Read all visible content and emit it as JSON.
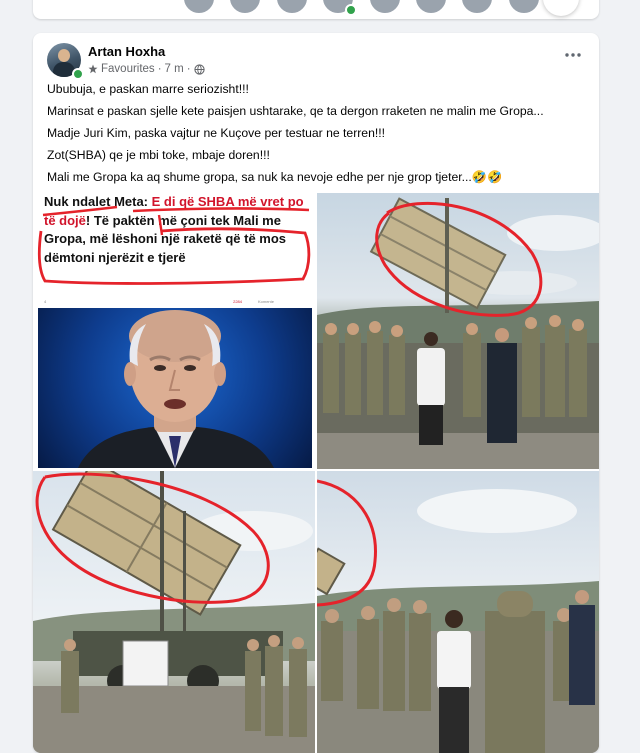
{
  "post": {
    "author": "Artan Hoxha",
    "audience": "Favourites",
    "separator": "·",
    "time": "7 m",
    "separator2": "·",
    "paragraphs": [
      "Ububuja, e paskan marre seriozisht!!!",
      "Marinsat e paskan sjelle kete paisjen ushtarake, qe ta dergon rraketen ne malin me Gropa...",
      "Madje Juri Kim, paska vajtur ne Kuçove per testuar ne terren!!!",
      "Zot(SHBA) qe je mbi toke, mbaje doren!!!",
      "Mali me Gropa ka aq shume gropa, sa nuk ka nevoje edhe per nje grop tjeter...🤣🤣"
    ]
  },
  "article": {
    "headline_dark": "Nuk ndalet Meta:",
    "headline_red": "E di që SHBA më vret po të dojë",
    "headline_rest": "! Të paktën më çoni tek Mali me Gropa, më lëshoni një raketë që të mos dëmtoni njerëzit e tjerë",
    "meta_left": "4 ",
    "likes": "2284",
    "comments": "Komente"
  },
  "colors": {
    "accent_red": "#d1142b",
    "online": "#31a24c",
    "annotation_red": "#e5232b"
  },
  "icons": {
    "audience": "star-icon",
    "privacy": "globe-icon",
    "menu": "more-horizontal-icon"
  }
}
